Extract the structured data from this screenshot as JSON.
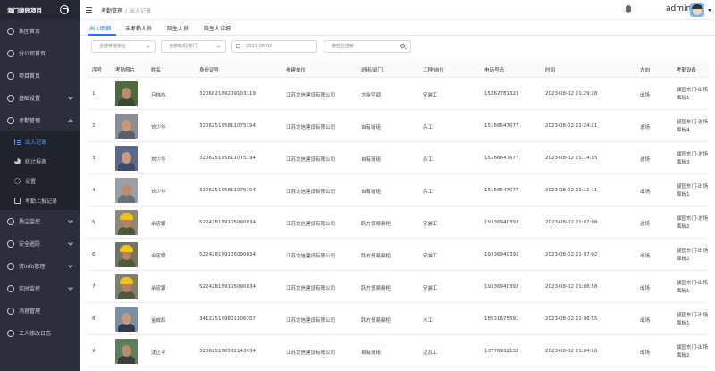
{
  "app": {
    "title": "海门骏园项目"
  },
  "sidebar": {
    "items": [
      {
        "label": "集团首页",
        "icon": "circle-icon"
      },
      {
        "label": "分公司首页",
        "icon": "circle-icon"
      },
      {
        "label": "项目首页",
        "icon": "circle-icon"
      },
      {
        "label": "基础设置",
        "icon": "circle-icon",
        "expandable": true
      },
      {
        "label": "考勤管理",
        "icon": "circle-icon",
        "expanded": true
      }
    ],
    "submenu": [
      {
        "label": "出入记录",
        "icon": "list-icon",
        "active": true
      },
      {
        "label": "统计报表",
        "icon": "pie-icon"
      },
      {
        "label": "设置",
        "icon": "gear-icon"
      },
      {
        "label": "考勤上报记录",
        "icon": "document-icon"
      }
    ],
    "items2": [
      {
        "label": "扬尘监控",
        "icon": "circle-icon",
        "expandable": true
      },
      {
        "label": "安全巡防",
        "icon": "circle-icon",
        "expandable": true
      },
      {
        "label": "资info管理",
        "icon": "circle-icon",
        "expandable": true
      },
      {
        "label": "实时监控",
        "icon": "circle-icon",
        "expandable": true
      },
      {
        "label": "消息管理",
        "icon": "circle-icon"
      },
      {
        "label": "工人修改日志",
        "icon": "circle-icon"
      }
    ]
  },
  "header": {
    "breadcrumb": [
      "考勤管理",
      "出入记录"
    ],
    "user": "admin"
  },
  "tabs": [
    "出入明细",
    "未考勤人员",
    "陪生人员",
    "陪生人详细"
  ],
  "filters": {
    "unit_placeholder": "全部参建单位",
    "team_placeholder": "全部班组/部门",
    "date_value": "2023-08-02",
    "name_placeholder": "按姓名搜索"
  },
  "table": {
    "columns": [
      "序号",
      "考勤照片",
      "姓名",
      "身份证号",
      "参建单位",
      "班组/部门",
      "工种/岗位",
      "电话号码",
      "时间",
      "方向",
      "考勤设备"
    ],
    "rows": [
      {
        "no": "1",
        "name": "吕炜炜",
        "id": "320682199209103119",
        "unit": "江苏龙信建设有限公司",
        "team": "大金空调",
        "job": "安装工",
        "phone": "15262781323",
        "time": "2023-08-02 21:29:28",
        "dir": "出场",
        "device": "骏园东门-出场面板1"
      },
      {
        "no": "2",
        "name": "刘少华",
        "id": "320625195811075194",
        "unit": "江苏龙信建设有限公司",
        "team": "自有班组",
        "job": "杂工",
        "phone": "15166647677",
        "time": "2023-08-02 21:24:21",
        "dir": "进场",
        "device": "骏园东门-进场面板4"
      },
      {
        "no": "3",
        "name": "刘少华",
        "id": "320625195811075194",
        "unit": "江苏龙信建设有限公司",
        "team": "自有班组",
        "job": "杂工",
        "phone": "15166647677",
        "time": "2023-08-02 21:14:35",
        "dir": "进场",
        "device": "骏园东门-进场面板3"
      },
      {
        "no": "4",
        "name": "刘少华",
        "id": "320625195811075194",
        "unit": "江苏龙信建设有限公司",
        "team": "自有班组",
        "job": "杂工",
        "phone": "15166647677",
        "time": "2023-08-02 21:11:11",
        "dir": "出场",
        "device": "骏园东门-出场面板1"
      },
      {
        "no": "5",
        "name": "余忠银",
        "id": "522428199105090034",
        "unit": "江苏龙信建设有限公司",
        "team": "跃方贸易橱柜",
        "job": "安装工",
        "phone": "19336940392",
        "time": "2023-08-02 21:07:08",
        "dir": "进场",
        "device": "骏园东门-进场面板2"
      },
      {
        "no": "6",
        "name": "余忠银",
        "id": "522428199105090034",
        "unit": "江苏龙信建设有限公司",
        "team": "跃方贸易橱柜",
        "job": "安装工",
        "phone": "19336940392",
        "time": "2023-08-02 21:07:02",
        "dir": "出场",
        "device": "骏园东门-出场面板2"
      },
      {
        "no": "7",
        "name": "余忠银",
        "id": "522428199105090034",
        "unit": "江苏龙信建设有限公司",
        "team": "跃方贸易橱柜",
        "job": "安装工",
        "phone": "19336940392",
        "time": "2023-08-02 21:06:58",
        "dir": "出场",
        "device": "骏园东门-出场面板1"
      },
      {
        "no": "8",
        "name": "金成辉",
        "id": "341225199801106357",
        "unit": "江苏龙信建设有限公司",
        "team": "跃方贸易橱柜",
        "job": "木工",
        "phone": "18531675591",
        "time": "2023-08-02 21:06:55",
        "dir": "出场",
        "device": "骏园东门-出场面板1"
      },
      {
        "no": "9",
        "name": "沈正平",
        "id": "320625196502143434",
        "unit": "江苏龙信建设有限公司",
        "team": "自有班组",
        "job": "泥瓦工",
        "phone": "13776932132",
        "time": "2023-08-02 21:04:18",
        "dir": "出场",
        "device": "骏园东门-出场面板2"
      }
    ]
  },
  "colors": {
    "accent": "#1677ff",
    "sidebar_bg": "#2b2f3a",
    "active_sub": "#4a9dff"
  }
}
